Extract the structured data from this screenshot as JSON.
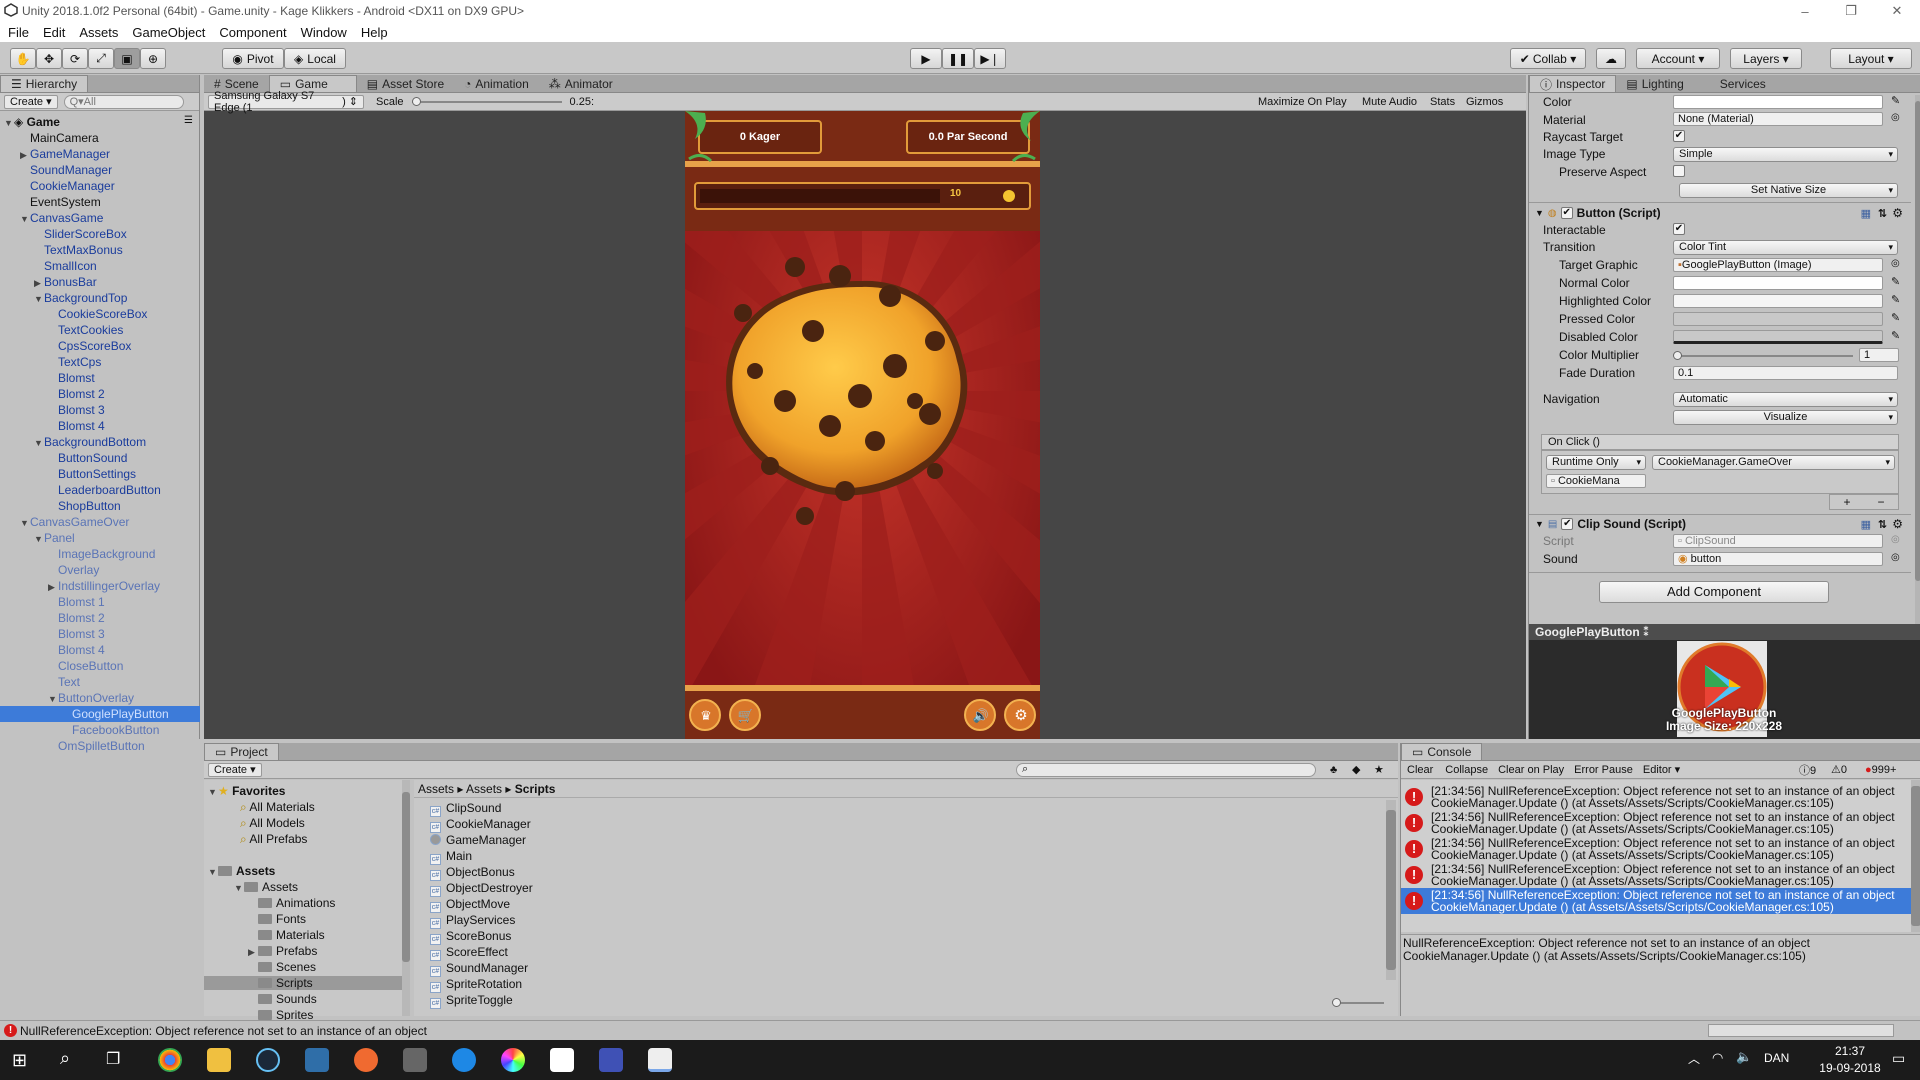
{
  "window": {
    "title": "Unity 2018.1.0f2 Personal (64bit) - Game.unity - Kage Klikkers - Android <DX11 on DX9 GPU>",
    "min": "–",
    "max": "❐",
    "close": "✕"
  },
  "menu": [
    "File",
    "Edit",
    "Assets",
    "GameObject",
    "Component",
    "Window",
    "Help"
  ],
  "toolbar": {
    "pivot": "Pivot",
    "local": "Local",
    "collab": "Collab",
    "account": "Account",
    "layers": "Layers",
    "layout": "Layout"
  },
  "hierarchy": {
    "tab": "Hierarchy",
    "create": "Create",
    "search": "Q▾All",
    "root": "Game",
    "items": [
      {
        "label": "MainCamera",
        "depth": 1,
        "blue": false,
        "arrow": ""
      },
      {
        "label": "GameManager",
        "depth": 1,
        "blue": true,
        "arrow": "▶"
      },
      {
        "label": "SoundManager",
        "depth": 1,
        "blue": true,
        "arrow": ""
      },
      {
        "label": "CookieManager",
        "depth": 1,
        "blue": true,
        "arrow": ""
      },
      {
        "label": "EventSystem",
        "depth": 1,
        "blue": false,
        "arrow": ""
      },
      {
        "label": "CanvasGame",
        "depth": 1,
        "blue": true,
        "arrow": "▼"
      },
      {
        "label": "SliderScoreBox",
        "depth": 2,
        "blue": true,
        "arrow": ""
      },
      {
        "label": "TextMaxBonus",
        "depth": 2,
        "blue": true,
        "arrow": ""
      },
      {
        "label": "SmallIcon",
        "depth": 2,
        "blue": true,
        "arrow": ""
      },
      {
        "label": "BonusBar",
        "depth": 2,
        "blue": true,
        "arrow": "▶"
      },
      {
        "label": "BackgroundTop",
        "depth": 2,
        "blue": true,
        "arrow": "▼"
      },
      {
        "label": "CookieScoreBox",
        "depth": 3,
        "blue": true,
        "arrow": ""
      },
      {
        "label": "TextCookies",
        "depth": 3,
        "blue": true,
        "arrow": ""
      },
      {
        "label": "CpsScoreBox",
        "depth": 3,
        "blue": true,
        "arrow": ""
      },
      {
        "label": "TextCps",
        "depth": 3,
        "blue": true,
        "arrow": ""
      },
      {
        "label": "Blomst",
        "depth": 3,
        "blue": true,
        "arrow": ""
      },
      {
        "label": "Blomst 2",
        "depth": 3,
        "blue": true,
        "arrow": ""
      },
      {
        "label": "Blomst 3",
        "depth": 3,
        "blue": true,
        "arrow": ""
      },
      {
        "label": "Blomst 4",
        "depth": 3,
        "blue": true,
        "arrow": ""
      },
      {
        "label": "BackgroundBottom",
        "depth": 2,
        "blue": true,
        "arrow": "▼"
      },
      {
        "label": "ButtonSound",
        "depth": 3,
        "blue": true,
        "arrow": ""
      },
      {
        "label": "ButtonSettings",
        "depth": 3,
        "blue": true,
        "arrow": ""
      },
      {
        "label": "LeaderboardButton",
        "depth": 3,
        "blue": true,
        "arrow": ""
      },
      {
        "label": "ShopButton",
        "depth": 3,
        "blue": true,
        "arrow": ""
      },
      {
        "label": "CanvasGameOver",
        "depth": 1,
        "blue": true,
        "dim": true,
        "arrow": "▼"
      },
      {
        "label": "Panel",
        "depth": 2,
        "blue": true,
        "dim": true,
        "arrow": "▼"
      },
      {
        "label": "ImageBackground",
        "depth": 3,
        "blue": true,
        "dim": true,
        "arrow": ""
      },
      {
        "label": "Overlay",
        "depth": 3,
        "blue": true,
        "dim": true,
        "arrow": ""
      },
      {
        "label": "IndstillingerOverlay",
        "depth": 3,
        "blue": true,
        "dim": true,
        "arrow": "▶"
      },
      {
        "label": "Blomst 1",
        "depth": 3,
        "blue": true,
        "dim": true,
        "arrow": ""
      },
      {
        "label": "Blomst 2",
        "depth": 3,
        "blue": true,
        "dim": true,
        "arrow": ""
      },
      {
        "label": "Blomst 3",
        "depth": 3,
        "blue": true,
        "dim": true,
        "arrow": ""
      },
      {
        "label": "Blomst 4",
        "depth": 3,
        "blue": true,
        "dim": true,
        "arrow": ""
      },
      {
        "label": "CloseButton",
        "depth": 3,
        "blue": true,
        "dim": true,
        "arrow": ""
      },
      {
        "label": "Text",
        "depth": 3,
        "blue": true,
        "dim": true,
        "arrow": ""
      },
      {
        "label": "ButtonOverlay",
        "depth": 3,
        "blue": true,
        "dim": true,
        "arrow": "▼"
      },
      {
        "label": "GooglePlayButton",
        "depth": 4,
        "blue": true,
        "sel": true,
        "arrow": ""
      },
      {
        "label": "FacebookButton",
        "depth": 4,
        "blue": true,
        "dim": true,
        "arrow": ""
      },
      {
        "label": "OmSpilletButton",
        "depth": 3,
        "blue": true,
        "dim": true,
        "arrow": ""
      }
    ]
  },
  "sceneTabs": [
    "Scene",
    "Game",
    "Asset Store",
    "Animation",
    "Animator"
  ],
  "gameBar": {
    "device": "Samsung Galaxy S7 Edge (1",
    "scale_label": "Scale",
    "scale_value": "0.25:",
    "maximize": "Maximize On Play",
    "mute": "Mute Audio",
    "stats": "Stats",
    "gizmos": "Gizmos"
  },
  "game": {
    "cookies": "0 Kager",
    "per_second": "0.0 Par Second",
    "bonus": "10"
  },
  "inspector": {
    "tab": "Inspector",
    "lighting": "Lighting",
    "services": "Services",
    "color_label": "Color",
    "material_label": "Material",
    "material_value": "None (Material)",
    "raycast_label": "Raycast Target",
    "image_type_label": "Image Type",
    "image_type_value": "Simple",
    "preserve_label": "Preserve Aspect",
    "set_native": "Set Native Size",
    "button_header": "Button (Script)",
    "interactable": "Interactable",
    "transition": "Transition",
    "transition_value": "Color Tint",
    "target_graphic": "Target Graphic",
    "target_graphic_value": "GooglePlayButton (Image)",
    "normal": "Normal Color",
    "highlighted": "Highlighted Color",
    "pressed": "Pressed Color",
    "disabled": "Disabled Color",
    "multiplier": "Color Multiplier",
    "multiplier_value": "1",
    "fade": "Fade Duration",
    "fade_value": "0.1",
    "navigation": "Navigation",
    "navigation_value": "Automatic",
    "visualize": "Visualize",
    "onclick": "On Click ()",
    "runtime": "Runtime Only",
    "method": "CookieManager.GameOver",
    "object": "CookieMana",
    "plus": "+",
    "minus": "−",
    "clip_header": "Clip Sound (Script)",
    "script_label": "Script",
    "script_value": "ClipSound",
    "sound_label": "Sound",
    "sound_value": "button",
    "add_component": "Add Component",
    "preview_title": "GooglePlayButton",
    "preview_name": "GooglePlayButton",
    "preview_size": "Image Size: 220x228"
  },
  "project": {
    "tab": "Project",
    "create": "Create",
    "favorites": "Favorites",
    "fav_items": [
      "All Materials",
      "All Models",
      "All Prefabs"
    ],
    "assets": "Assets",
    "tree": [
      {
        "label": "Assets",
        "d": 1
      },
      {
        "label": "Animations",
        "d": 2
      },
      {
        "label": "Fonts",
        "d": 2
      },
      {
        "label": "Materials",
        "d": 2
      },
      {
        "label": "Prefabs",
        "d": 2
      },
      {
        "label": "Scenes",
        "d": 2
      },
      {
        "label": "Scripts",
        "d": 2,
        "sel": true
      },
      {
        "label": "Sounds",
        "d": 2
      },
      {
        "label": "Sprites",
        "d": 2
      }
    ],
    "breadcrumb": [
      "Assets",
      "Assets",
      "Scripts"
    ],
    "files": [
      "ClipSound",
      "CookieManager",
      "GameManager",
      "Main",
      "ObjectBonus",
      "ObjectDestroyer",
      "ObjectMove",
      "PlayServices",
      "ScoreBonus",
      "ScoreEffect",
      "SoundManager",
      "SpriteRotation",
      "SpriteToggle"
    ]
  },
  "console": {
    "tab": "Console",
    "clear": "Clear",
    "collapse": "Collapse",
    "clear_on_play": "Clear on Play",
    "error_pause": "Error Pause",
    "editor": "Editor",
    "count_info": "9",
    "count_warn": "0",
    "count_err": "999+",
    "line1": "[21:34:56] NullReferenceException: Object reference not set to an instance of an object",
    "line2": "CookieManager.Update () (at Assets/Assets/Scripts/CookieManager.cs:105)",
    "detail1": "NullReferenceException: Object reference not set to an instance of an object",
    "detail2": "CookieManager.Update () (at Assets/Assets/Scripts/CookieManager.cs:105)"
  },
  "status": "NullReferenceException: Object reference not set to an instance of an object",
  "taskbar": {
    "lang": "DAN",
    "time": "21:37",
    "date": "19-09-2018"
  }
}
